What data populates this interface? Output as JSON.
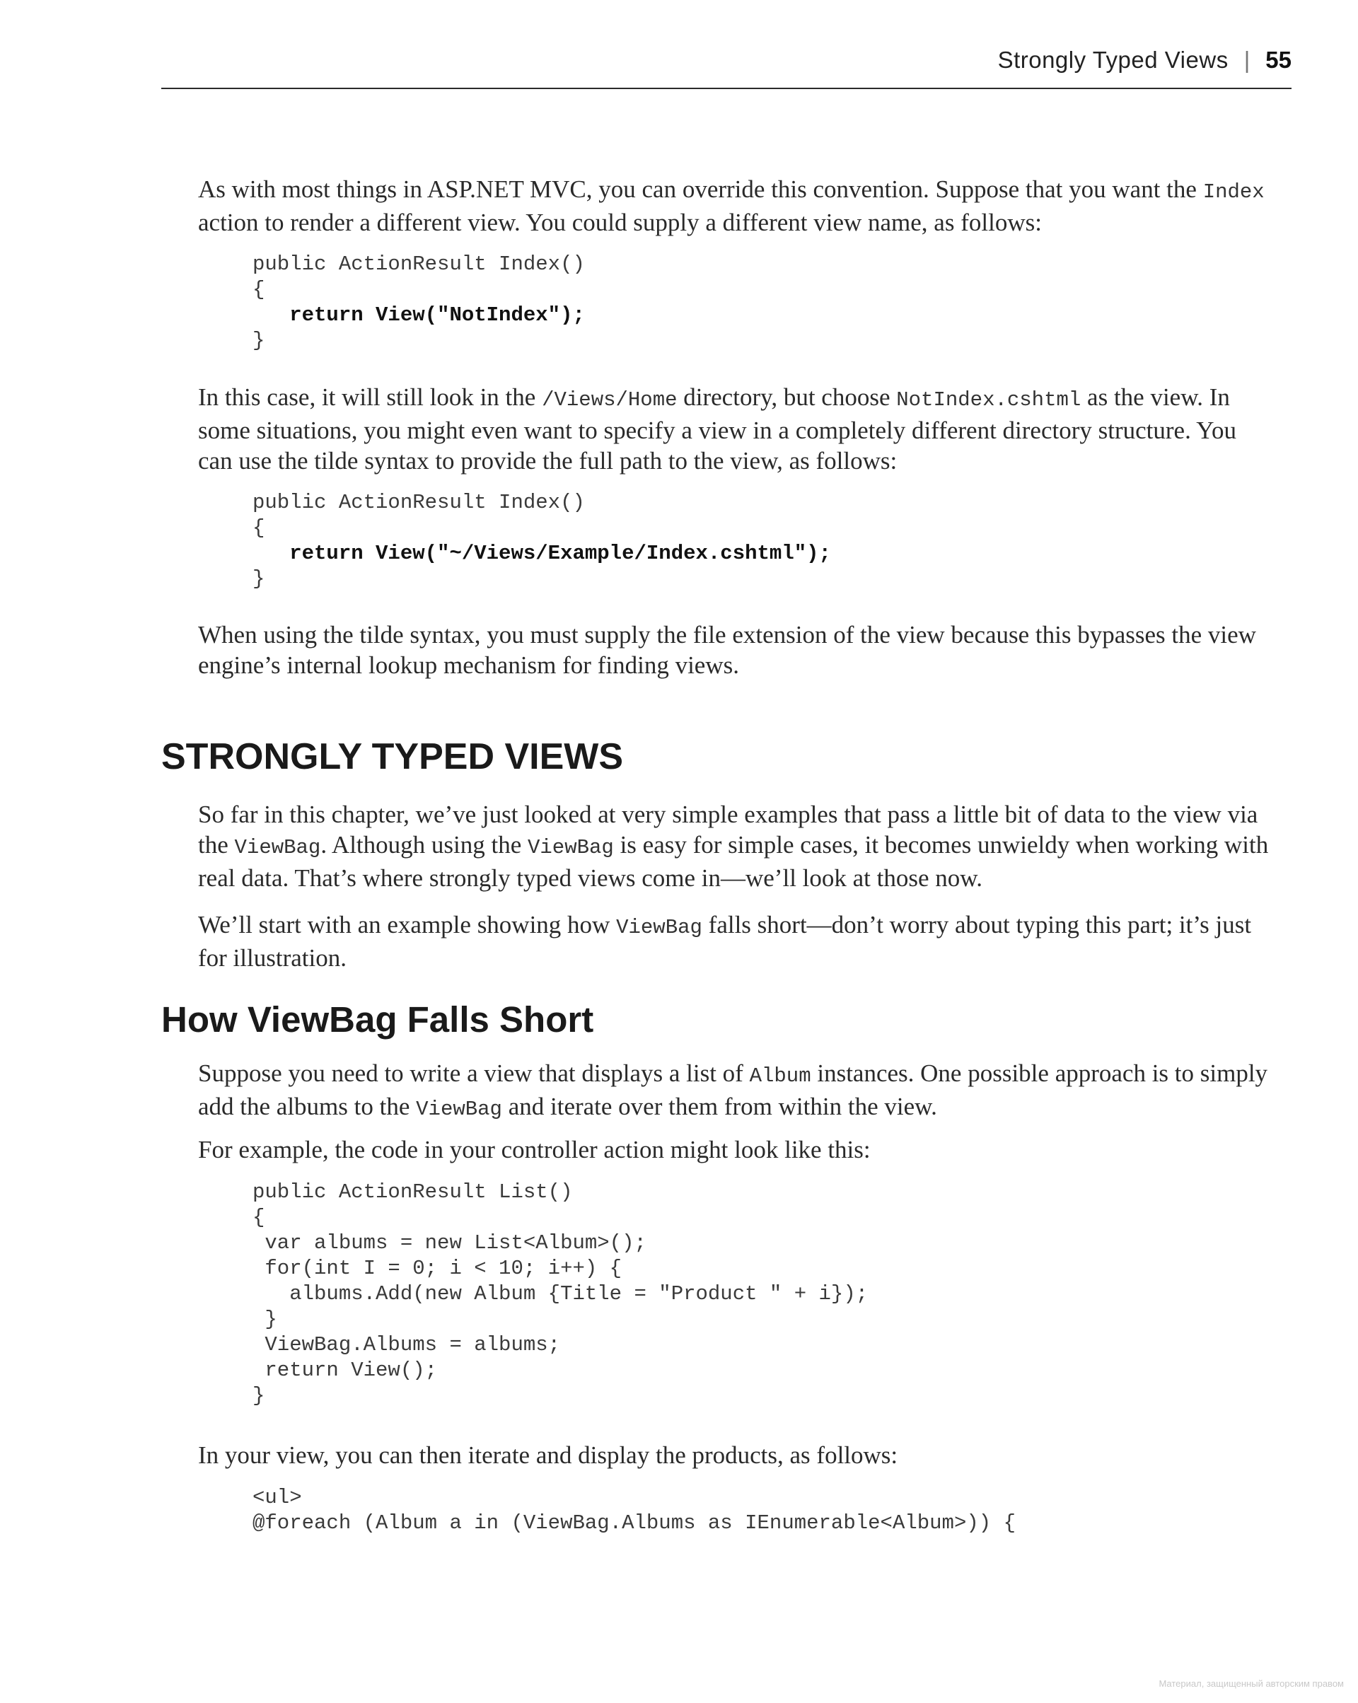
{
  "header": {
    "section_title": "Strongly Typed Views",
    "separator": "|",
    "page_number": "55"
  },
  "para1": {
    "t1": "As with most things in ASP.NET MVC, you can override this convention. Suppose that you want the ",
    "c1": "Index",
    "t2": " action to render a different view. You could supply a different view name, as follows:"
  },
  "code1": {
    "l1": "public ActionResult Index()",
    "l2": "{",
    "l3": "   return View(\"NotIndex\");",
    "l4": "}"
  },
  "para2": {
    "t1": "In this case, it will still look in the ",
    "c1": "/Views/Home",
    "t2": " directory, but choose ",
    "c2": "NotIndex.cshtml",
    "t3": " as the view. In some situations, you might even want to specify a view in a completely different directory structure. You can use the tilde syntax to provide the full path to the view, as follows:"
  },
  "code2": {
    "l1": "public ActionResult Index()",
    "l2": "{",
    "l3": "   return View(\"~/Views/Example/Index.cshtml\");",
    "l4": "}"
  },
  "para3": {
    "text": "When using the tilde syntax, you must supply the file extension of the view because this bypasses the view engine’s internal lookup mechanism for finding views."
  },
  "heading_major": "STRONGLY TYPED VIEWS",
  "para4": {
    "t1": "So far in this chapter, we’ve just looked at very simple examples that pass a little bit of data to the view via the ",
    "c1": "ViewBag",
    "t2": ". Although using the ",
    "c2": "ViewBag",
    "t3": " is easy for simple cases, it becomes unwieldy when working with real data. That’s where strongly typed views come in—we’ll look at those now."
  },
  "para5": {
    "t1": "We’ll start with an example showing how ",
    "c1": "ViewBag",
    "t2": " falls short—don’t worry about typing this part; it’s just for illustration."
  },
  "heading_minor": "How ViewBag Falls Short",
  "para6": {
    "t1": "Suppose you need to write a view that displays a list of ",
    "c1": "Album",
    "t2": " instances. One possible approach is to simply add the albums to the ",
    "c2": "ViewBag",
    "t3": " and iterate over them from within the view."
  },
  "para7": {
    "text": "For example, the code in your controller action might look like this:"
  },
  "code3": {
    "l1": "public ActionResult List()",
    "l2": "{",
    "l3": " var albums = new List<Album>();",
    "l4": " for(int I = 0; i < 10; i++) {",
    "l5": "   albums.Add(new Album {Title = \"Product \" + i});",
    "l6": " }",
    "l7": " ViewBag.Albums = albums;",
    "l8": " return View();",
    "l9": "}"
  },
  "para8": {
    "text": "In your view, you can then iterate and display the products, as follows:"
  },
  "code4": {
    "l1": "<ul>",
    "l2": "@foreach (Album a in (ViewBag.Albums as IEnumerable<Album>)) {"
  },
  "watermark": "Материал, защищенный авторским правом"
}
